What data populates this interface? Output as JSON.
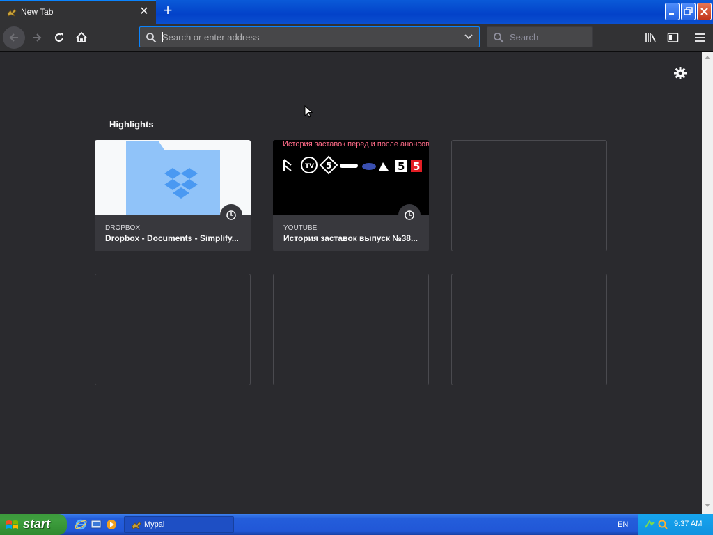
{
  "window": {
    "tab_title": "New Tab",
    "tab_close_glyph": "✕",
    "new_tab_glyph": "+",
    "accent": "#0a84ff"
  },
  "toolbar": {
    "url_placeholder": "Search or enter address",
    "search_placeholder": "Search"
  },
  "content": {
    "section_title": "Highlights",
    "cards": [
      {
        "source": "DROPBOX",
        "title": "Dropbox - Documents - Simplify..."
      },
      {
        "source": "YOUTUBE",
        "title": "История заставок выпуск №38...",
        "thumb_text": "История заставок перед и после анонсов"
      }
    ]
  },
  "taskbar": {
    "start_label": "start",
    "task_label": "Mypal",
    "lang": "EN",
    "clock": "9:37 AM"
  }
}
